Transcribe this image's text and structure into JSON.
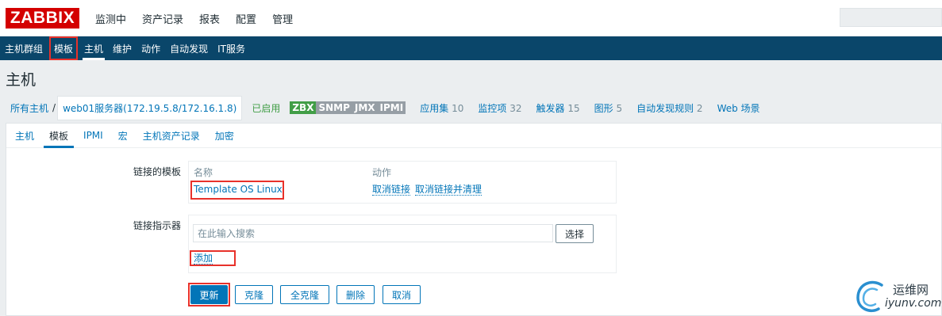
{
  "app": {
    "logo": "ZABBIX",
    "top_menu": [
      "监测中",
      "资产记录",
      "报表",
      "配置",
      "管理"
    ]
  },
  "sub_nav": {
    "items": [
      "主机群组",
      "模板",
      "主机",
      "维护",
      "动作",
      "自动发现",
      "IT服务"
    ],
    "active": "主机",
    "highlighted": "模板"
  },
  "page": {
    "title": "主机"
  },
  "breadcrumb": {
    "all_hosts": "所有主机",
    "separator": "/",
    "current_host": "web01服务器(172.19.5.8/172.16.1.8)"
  },
  "host_status": {
    "enabled": "已启用",
    "availability": [
      {
        "label": "ZBX",
        "color": "#429e47"
      },
      {
        "label": "SNMP",
        "color": "#969ea5"
      },
      {
        "label": "JMX",
        "color": "#969ea5"
      },
      {
        "label": "IPMI",
        "color": "#969ea5"
      }
    ],
    "links": [
      {
        "label": "应用集",
        "count": "10"
      },
      {
        "label": "监控项",
        "count": "32"
      },
      {
        "label": "触发器",
        "count": "15"
      },
      {
        "label": "图形",
        "count": "5"
      },
      {
        "label": "自动发现规则",
        "count": "2"
      },
      {
        "label": "Web 场景",
        "count": ""
      }
    ]
  },
  "tabs": {
    "items": [
      "主机",
      "模板",
      "IPMI",
      "宏",
      "主机资产记录",
      "加密"
    ],
    "active": "模板"
  },
  "linked_templates": {
    "label": "链接的模板",
    "col_name": "名称",
    "col_action": "动作",
    "template_name": "Template OS Linux",
    "unlink": "取消链接",
    "unlink_clear": "取消链接并清理"
  },
  "link_indicator": {
    "label": "链接指示器",
    "search_placeholder": "在此输入搜索",
    "select_button": "选择",
    "add_link": "添加"
  },
  "actions": {
    "update": "更新",
    "clone": "克隆",
    "full_clone": "全克隆",
    "delete": "删除",
    "cancel": "取消"
  },
  "watermark": {
    "cn": "运维网",
    "en": "iyunv.com"
  },
  "colors": {
    "header_nav": "#0a466a",
    "link": "#0275b8",
    "highlight_box": "#e8312a",
    "logo": "#d40000"
  }
}
